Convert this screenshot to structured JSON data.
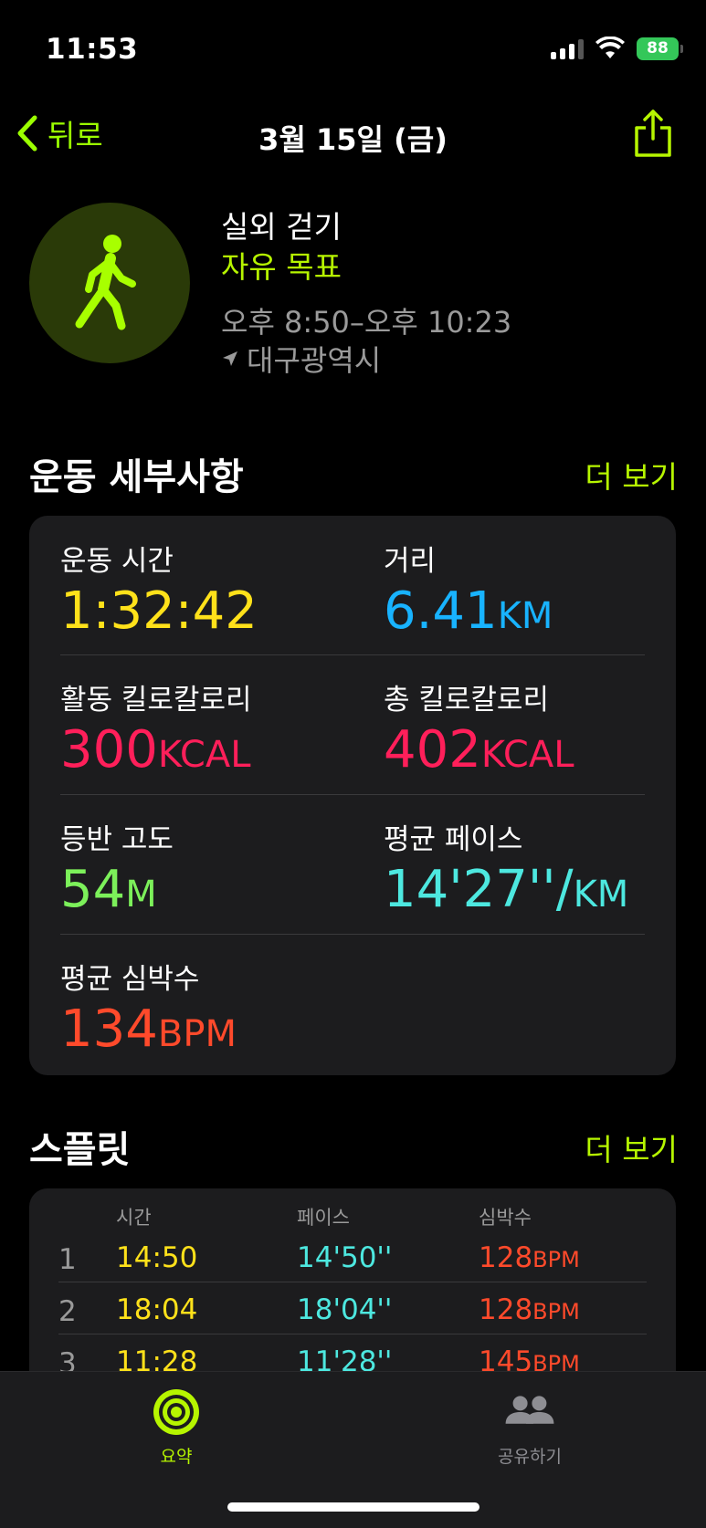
{
  "status": {
    "time": "11:53",
    "battery": "88"
  },
  "nav": {
    "back_label": "뒤로",
    "title": "3월 15일 (금)"
  },
  "workout": {
    "type": "실외 걷기",
    "goal": "자유 목표",
    "time_range": "오후 8:50–오후 10:23",
    "location": "대구광역시"
  },
  "details": {
    "title": "운동 세부사항",
    "more": "더 보기",
    "metrics": [
      {
        "label": "운동 시간",
        "value": "1:32:42",
        "unit": "",
        "color": "#ffe11a"
      },
      {
        "label": "거리",
        "value": "6.41",
        "unit": "KM",
        "color": "#18b3ff"
      },
      {
        "label": "활동 킬로칼로리",
        "value": "300",
        "unit": "KCAL",
        "color": "#ff1f5a"
      },
      {
        "label": "총 킬로칼로리",
        "value": "402",
        "unit": "KCAL",
        "color": "#ff1f5a"
      },
      {
        "label": "등반 고도",
        "value": "54",
        "unit": "M",
        "color": "#7cf05a"
      },
      {
        "label": "평균 페이스",
        "value": "14'27''/",
        "unit": "KM",
        "color": "#4de8e0"
      },
      {
        "label": "평균 심박수",
        "value": "134",
        "unit": "BPM",
        "color": "#ff4a2b"
      }
    ]
  },
  "splits": {
    "title": "스플릿",
    "more": "더 보기",
    "headers": {
      "time": "시간",
      "pace": "페이스",
      "heart": "심박수"
    },
    "rows": [
      {
        "n": "1",
        "time": "14:50",
        "pace": "14'50''",
        "hr": "128",
        "unit": "BPM"
      },
      {
        "n": "2",
        "time": "18:04",
        "pace": "18'04''",
        "hr": "128",
        "unit": "BPM"
      },
      {
        "n": "3",
        "time": "11:28",
        "pace": "11'28''",
        "hr": "145",
        "unit": "BPM"
      }
    ]
  },
  "tabs": {
    "summary": "요약",
    "sharing": "공유하기"
  },
  "colors": {
    "accent": "#b6f500",
    "background": "#000000",
    "card": "#1c1c1e"
  }
}
